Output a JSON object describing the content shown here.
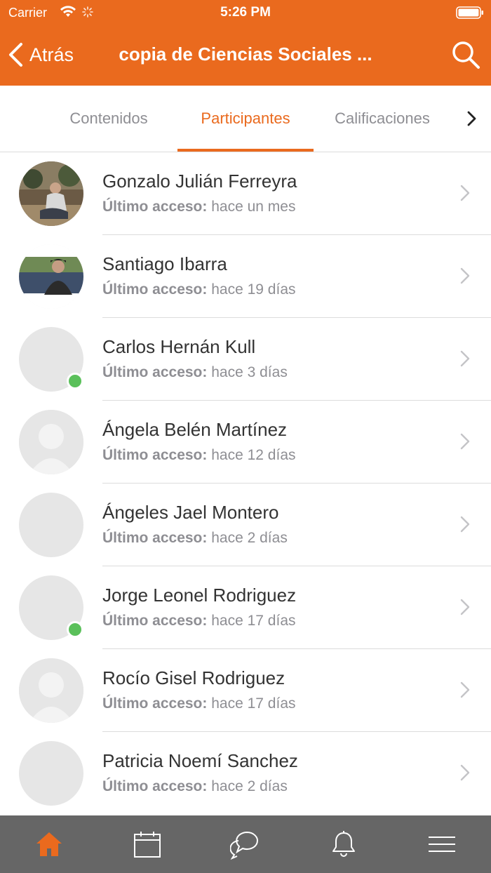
{
  "status_bar": {
    "carrier": "Carrier",
    "time": "5:26 PM"
  },
  "navbar": {
    "back_label": "Atrás",
    "title": "copia de Ciencias Sociales ..."
  },
  "tabs": [
    {
      "label": "Contenidos",
      "active": false
    },
    {
      "label": "Participantes",
      "active": true
    },
    {
      "label": "Calificaciones",
      "active": false
    }
  ],
  "participants": [
    {
      "name": "Gonzalo Julián Ferreyra",
      "access_label": "Último acceso:",
      "access_value": "hace un mes",
      "avatar": "photo"
    },
    {
      "name": "Santiago Ibarra",
      "access_label": "Último acceso:",
      "access_value": "hace 19 días",
      "avatar": "photo"
    },
    {
      "name": "Carlos Hernán Kull",
      "access_label": "Último acceso:",
      "access_value": "hace 3 días",
      "avatar": "blank",
      "online": true
    },
    {
      "name": "Ángela Belén Martínez",
      "access_label": "Último acceso:",
      "access_value": "hace 12 días",
      "avatar": "default-user"
    },
    {
      "name": "Ángeles Jael Montero",
      "access_label": "Último acceso:",
      "access_value": "hace 2 días",
      "avatar": "blank"
    },
    {
      "name": "Jorge Leonel Rodriguez",
      "access_label": "Último acceso:",
      "access_value": "hace 17 días",
      "avatar": "blank",
      "online": true
    },
    {
      "name": "Rocío Gisel Rodriguez",
      "access_label": "Último acceso:",
      "access_value": "hace 17 días",
      "avatar": "default-user"
    },
    {
      "name": "Patricia Noemí Sanchez",
      "access_label": "Último acceso:",
      "access_value": "hace 2 días",
      "avatar": "blank"
    }
  ],
  "bottom_tabs": [
    {
      "icon": "home-icon",
      "active": true
    },
    {
      "icon": "calendar-icon",
      "active": false
    },
    {
      "icon": "chat-icon",
      "active": false
    },
    {
      "icon": "bell-icon",
      "active": false
    },
    {
      "icon": "menu-icon",
      "active": false
    }
  ],
  "colors": {
    "accent": "#EA6A1E",
    "online": "#5AC05A",
    "bottom_bar": "#666666"
  }
}
